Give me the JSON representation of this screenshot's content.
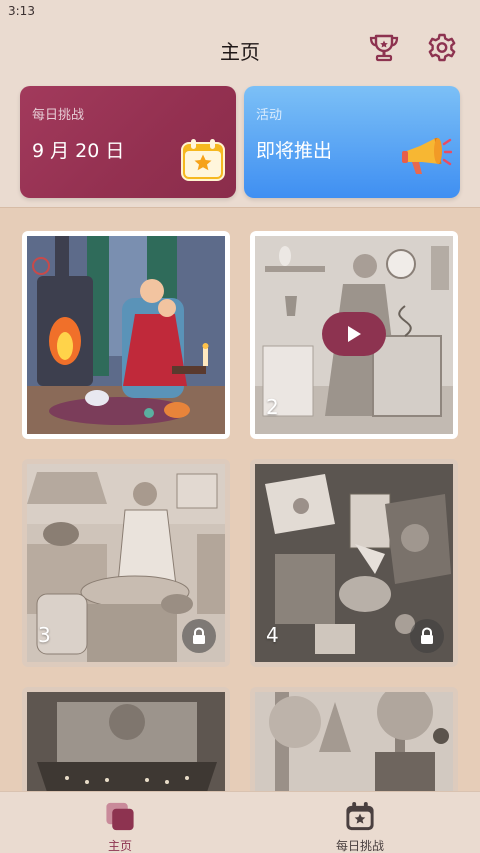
{
  "status_bar": {
    "time": "3:13"
  },
  "header": {
    "title": "主页",
    "trophy_icon": "trophy-icon",
    "settings_icon": "gear-icon",
    "icon_color": "#8d3350"
  },
  "cards": {
    "daily": {
      "label": "每日挑战",
      "date": "9 月 20 日",
      "icon": "calendar-star-icon",
      "color": "#a23a5c"
    },
    "event": {
      "label": "活动",
      "status": "即将推出",
      "icon": "megaphone-icon",
      "color": "#4a96f2"
    }
  },
  "puzzles": [
    {
      "number": "",
      "state": "completed-color"
    },
    {
      "number": "2",
      "state": "playable",
      "play_icon": "play-icon"
    },
    {
      "number": "3",
      "state": "locked",
      "lock_icon": "lock-icon"
    },
    {
      "number": "4",
      "state": "locked",
      "lock_icon": "lock-icon"
    },
    {
      "number": "",
      "state": "locked-partial"
    },
    {
      "number": "",
      "state": "locked-partial"
    }
  ],
  "bottom_nav": {
    "home": {
      "label": "主页",
      "icon": "home-cards-icon",
      "active": true,
      "color": "#8d3350"
    },
    "daily": {
      "label": "每日挑战",
      "icon": "calendar-star-icon",
      "active": false,
      "color": "#4a4040"
    }
  }
}
